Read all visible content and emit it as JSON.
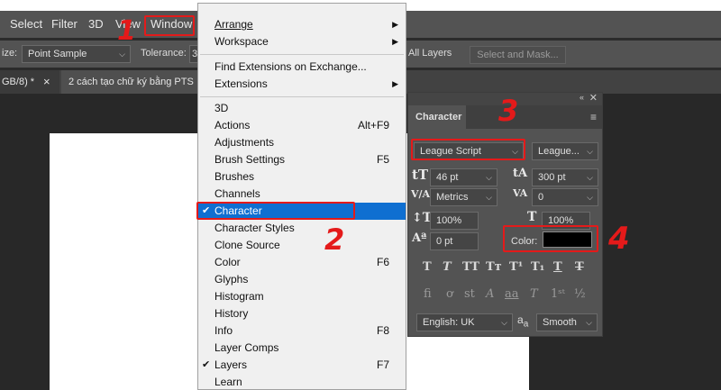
{
  "menubar": {
    "items": [
      "Select",
      "Filter",
      "3D",
      "View",
      "Window"
    ]
  },
  "options": {
    "size_label": "ize:",
    "sample_value": "Point Sample",
    "tolerance_label": "Tolerance:",
    "tolerance_value": "3",
    "all_layers": "All Layers",
    "select_mask": "Select and Mask..."
  },
  "tabs": {
    "tab1": "GB/8) *",
    "tab1_close": "×",
    "tab2": "2 cách tạo chữ ký bằng PTS"
  },
  "window_menu": {
    "arrange": "Arrange",
    "workspace": "Workspace",
    "find_extensions": "Find Extensions on Exchange...",
    "extensions": "Extensions",
    "i3d": "3D",
    "actions": "Actions",
    "actions_sc": "Alt+F9",
    "adjustments": "Adjustments",
    "brush_settings": "Brush Settings",
    "brush_settings_sc": "F5",
    "brushes": "Brushes",
    "channels": "Channels",
    "character": "Character",
    "character_styles": "Character Styles",
    "clone_source": "Clone Source",
    "color": "Color",
    "color_sc": "F6",
    "glyphs": "Glyphs",
    "histogram": "Histogram",
    "history": "History",
    "info": "Info",
    "info_sc": "F8",
    "layer_comps": "Layer Comps",
    "layers": "Layers",
    "layers_sc": "F7",
    "learn": "Learn",
    "check": "✔"
  },
  "character_panel": {
    "title": "Character",
    "font_family": "League Script",
    "font_style": "League...",
    "font_size": "46 pt",
    "leading": "300 pt",
    "kerning": "Metrics",
    "tracking": "0",
    "vscale": "100%",
    "hscale": "100%",
    "baseline": "0 pt",
    "color_label": "Color:",
    "color_value": "#000000",
    "language": "English: UK",
    "antialias_label": "a",
    "antialias_label2": "a",
    "antialias": "Smooth"
  },
  "annotations": {
    "a1": "1",
    "a2": "2",
    "a3": "3",
    "a4": "4"
  },
  "colors": {
    "annotation": "#e41a1a",
    "highlight": "#0f6fd1"
  }
}
